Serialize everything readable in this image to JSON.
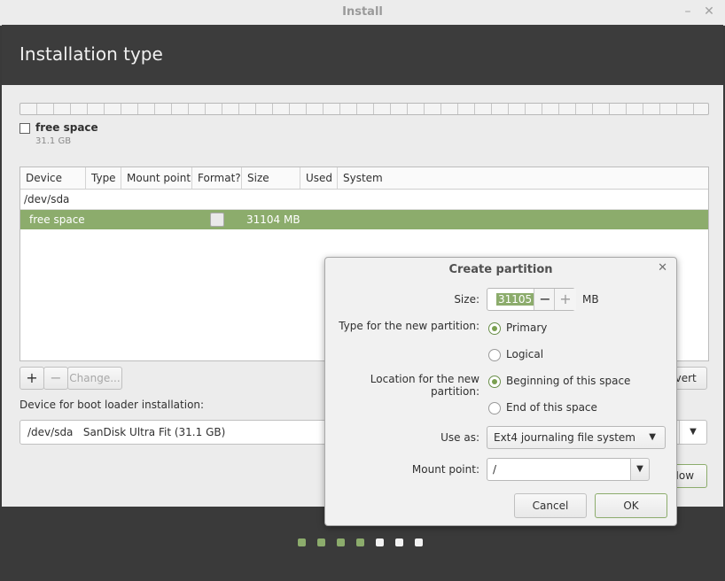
{
  "window": {
    "title": "Install",
    "minimize_glyph": "–",
    "close_glyph": "✕"
  },
  "header": {
    "title": "Installation type"
  },
  "partition_bar": {
    "legend_label": "free space",
    "legend_size": "31.1 GB"
  },
  "table": {
    "columns": [
      "Device",
      "Type",
      "Mount point",
      "Format?",
      "Size",
      "Used",
      "System"
    ],
    "device_row": "/dev/sda",
    "selected_row": {
      "device": "free space",
      "size": "31104 MB"
    }
  },
  "controls": {
    "add_label": "+",
    "remove_label": "−",
    "change_label": "Change...",
    "revert_label": "evert"
  },
  "bootloader": {
    "label": "Device for boot loader installation:",
    "device": "/dev/sda",
    "device_name": "SanDisk Ultra Fit (31.1 GB)"
  },
  "install_now_label": "Now",
  "progress": {
    "completed_steps": 4,
    "total_steps": 7
  },
  "dialog": {
    "title": "Create partition",
    "close_glyph": "✕",
    "size_label": "Size:",
    "size_value": "31105",
    "size_unit": "MB",
    "minus_label": "−",
    "plus_label": "+",
    "type_label": "Type for the new partition:",
    "type_options": [
      "Primary",
      "Logical"
    ],
    "type_selected": "Primary",
    "location_label": "Location for the new partition:",
    "location_options": [
      "Beginning of this space",
      "End of this space"
    ],
    "location_selected": "Beginning of this space",
    "use_as_label": "Use as:",
    "use_as_value": "Ext4 journaling file system",
    "mount_label": "Mount point:",
    "mount_value": "/",
    "cancel_label": "Cancel",
    "ok_label": "OK"
  },
  "colors": {
    "accent": "#8cac6c",
    "header_bg": "#3c3c3c",
    "window_bg": "#ececec"
  }
}
